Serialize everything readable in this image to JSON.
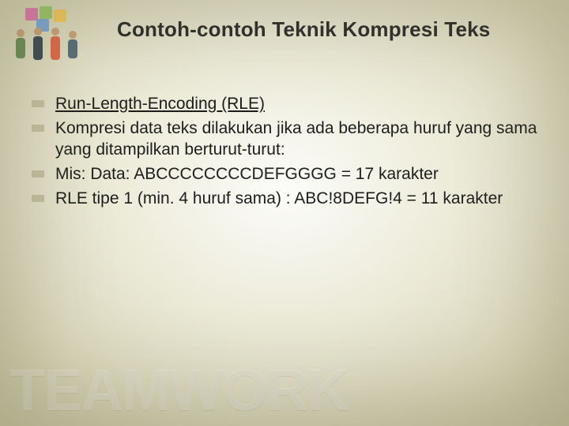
{
  "slide": {
    "title": "Contoh-contoh Teknik Kompresi Teks",
    "bullets": [
      {
        "text": "Run-Length-Encoding (RLE)",
        "underline": true
      },
      {
        "text": "Kompresi data teks dilakukan jika ada beberapa huruf yang sama yang ditampilkan berturut-turut:",
        "underline": false
      },
      {
        "text": "Mis:  Data:  ABCCCCCCCCDEFGGGG = 17 karakter",
        "underline": false
      },
      {
        "text": "RLE tipe 1 (min. 4 huruf sama) :  ABC!8DEFG!4 = 11 karakter",
        "underline": false
      }
    ],
    "watermark": "TEAMWORK"
  }
}
